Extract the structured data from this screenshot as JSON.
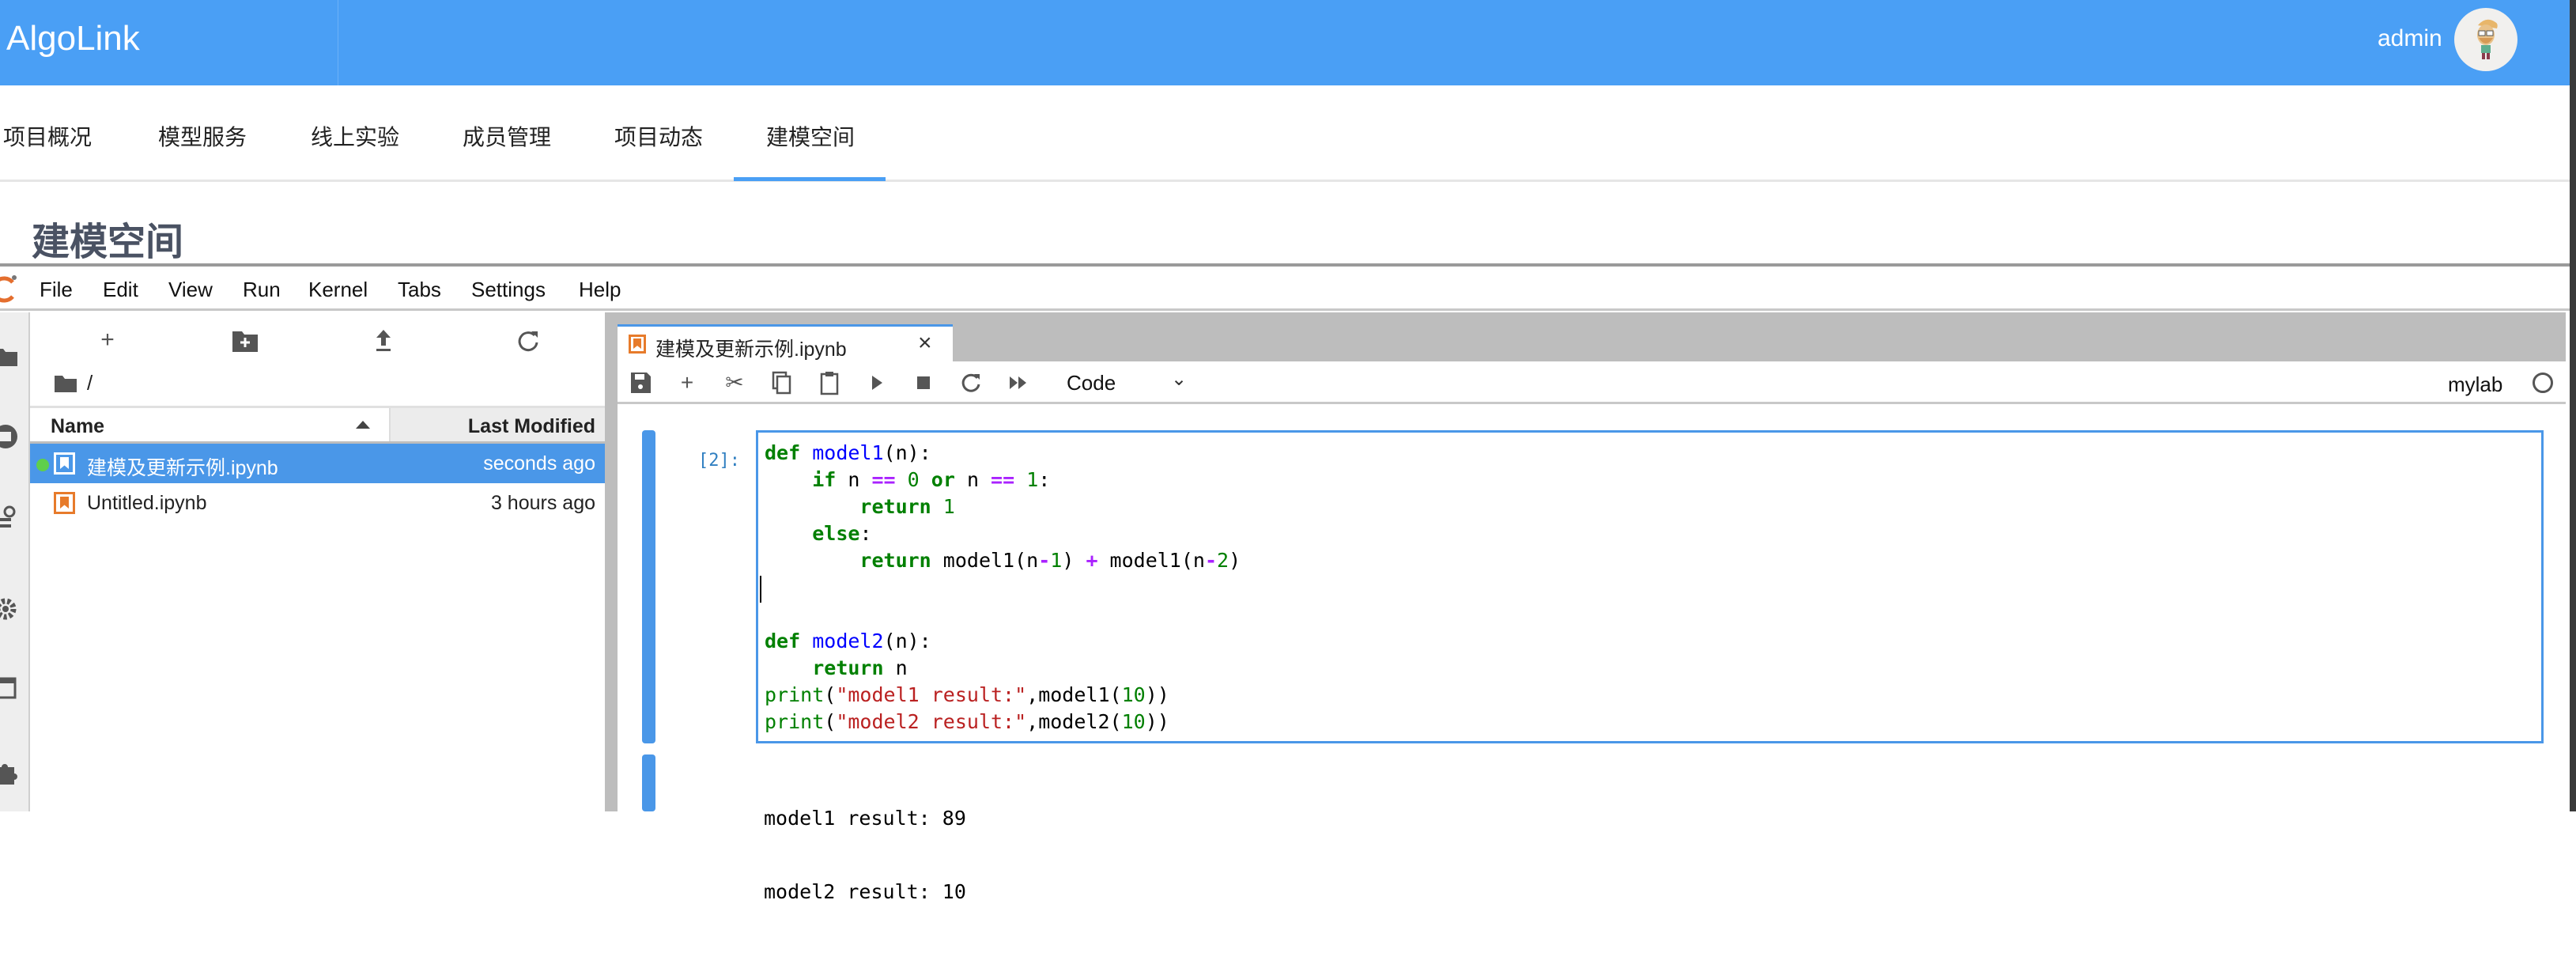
{
  "header": {
    "brand": "AlgoLink",
    "user": "admin",
    "accent": "#4a9ff5"
  },
  "nav": {
    "tabs": [
      "项目概况",
      "模型服务",
      "线上实验",
      "成员管理",
      "项目动态",
      "建模空间"
    ],
    "active": "建模空间"
  },
  "page_title": "建模空间",
  "menu": [
    "File",
    "Edit",
    "View",
    "Run",
    "Kernel",
    "Tabs",
    "Settings",
    "Help"
  ],
  "filebrowser": {
    "breadcrumb": "/",
    "columns": {
      "name": "Name",
      "modified": "Last Modified"
    },
    "files": [
      {
        "name": "建模及更新示例.ipynb",
        "modified": "seconds ago",
        "selected": true,
        "running": true
      },
      {
        "name": "Untitled.ipynb",
        "modified": "3 hours ago",
        "selected": false,
        "running": false
      }
    ]
  },
  "notebook": {
    "tab_title": "建模及更新示例.ipynb",
    "cell_type": "Code",
    "kernel": "mylab",
    "prompt": "[2]:",
    "code": [
      [
        [
          "def",
          "kw"
        ],
        [
          " ",
          ""
        ],
        [
          "model1",
          "fnm"
        ],
        [
          "(n):",
          ""
        ]
      ],
      [
        [
          "    ",
          ""
        ],
        [
          "if",
          "kw"
        ],
        [
          " n ",
          ""
        ],
        [
          "==",
          "op"
        ],
        [
          " ",
          ""
        ],
        [
          "0",
          "num"
        ],
        [
          " ",
          ""
        ],
        [
          "or",
          "kw"
        ],
        [
          " n ",
          ""
        ],
        [
          "==",
          "op"
        ],
        [
          " ",
          ""
        ],
        [
          "1",
          "num"
        ],
        [
          ":",
          ""
        ]
      ],
      [
        [
          "        ",
          ""
        ],
        [
          "return",
          "kw"
        ],
        [
          " ",
          ""
        ],
        [
          "1",
          "num"
        ]
      ],
      [
        [
          "    ",
          ""
        ],
        [
          "else",
          "kw"
        ],
        [
          ":",
          ""
        ]
      ],
      [
        [
          "        ",
          ""
        ],
        [
          "return",
          "kw"
        ],
        [
          " model1(n",
          ""
        ],
        [
          "-",
          "op"
        ],
        [
          "1",
          "num"
        ],
        [
          ") ",
          ""
        ],
        [
          "+",
          "op"
        ],
        [
          " model1(n",
          ""
        ],
        [
          "-",
          "op"
        ],
        [
          "2",
          "num"
        ],
        [
          ")",
          ""
        ]
      ],
      [],
      [],
      [
        [
          "def",
          "kw"
        ],
        [
          " ",
          ""
        ],
        [
          "model2",
          "fnm"
        ],
        [
          "(n):",
          ""
        ]
      ],
      [
        [
          "    ",
          ""
        ],
        [
          "return",
          "kw"
        ],
        [
          " n",
          ""
        ]
      ],
      [
        [
          "print",
          "bi"
        ],
        [
          "(",
          ""
        ],
        [
          "\"model1 result:\"",
          "str"
        ],
        [
          ",model1(",
          ""
        ],
        [
          "10",
          "num"
        ],
        [
          "))",
          ""
        ]
      ],
      [
        [
          "print",
          "bi"
        ],
        [
          "(",
          ""
        ],
        [
          "\"model2 result:\"",
          "str"
        ],
        [
          ",model2(",
          ""
        ],
        [
          "10",
          "num"
        ],
        [
          "))",
          ""
        ]
      ]
    ],
    "output": [
      "model1 result: 89",
      "model2 result: 10"
    ]
  }
}
